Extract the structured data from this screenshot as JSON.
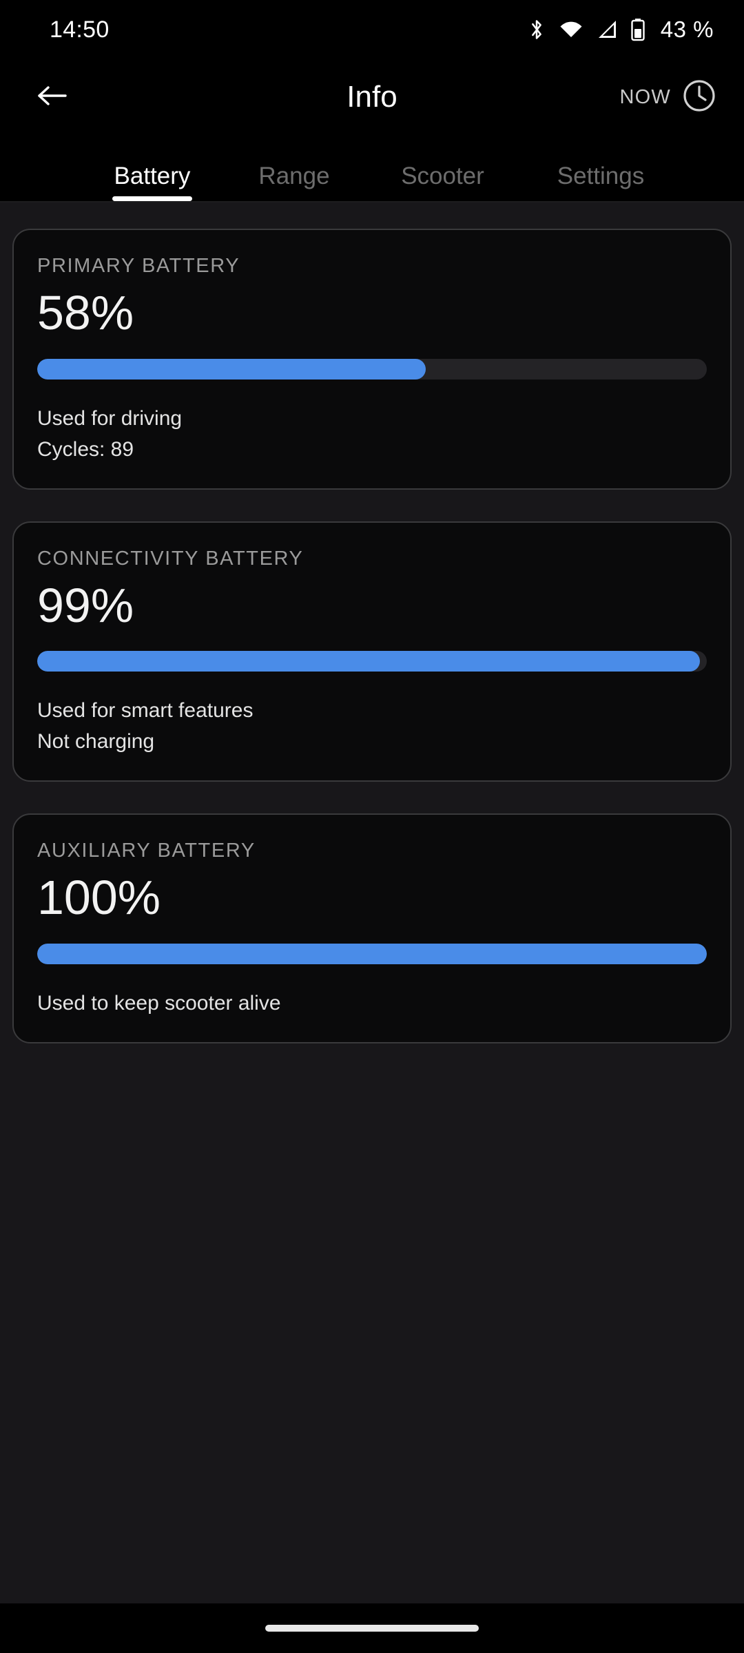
{
  "status_bar": {
    "time": "14:50",
    "battery_percent": "43 %",
    "icons": [
      "bluetooth-icon",
      "wifi-icon",
      "cellular-signal-icon",
      "battery-icon"
    ]
  },
  "header": {
    "back_icon": "arrow-left-icon",
    "title": "Info",
    "now_label": "NOW",
    "clock_icon": "clock-icon"
  },
  "tabs": [
    {
      "label": "Battery",
      "active": true
    },
    {
      "label": "Range",
      "active": false
    },
    {
      "label": "Scooter",
      "active": false
    },
    {
      "label": "Settings",
      "active": false
    }
  ],
  "cards": [
    {
      "title": "PRIMARY BATTERY",
      "value": "58%",
      "percent": 58,
      "notes": [
        "Used for driving",
        "Cycles: 89"
      ]
    },
    {
      "title": "CONNECTIVITY BATTERY",
      "value": "99%",
      "percent": 99,
      "notes": [
        "Used for smart features",
        "Not charging"
      ]
    },
    {
      "title": "AUXILIARY BATTERY",
      "value": "100%",
      "percent": 100,
      "notes": [
        "Used to keep scooter alive"
      ]
    }
  ],
  "colors": {
    "accent": "#4a8ce8",
    "track": "#242326",
    "content_bg": "#18171a",
    "card_bg": "#0a0a0b",
    "card_border": "#3a3a3c",
    "tab_active": "#ffffff",
    "tab_inactive": "#6d6d6d"
  },
  "nav_bar": {
    "gesture_pill": "home-gesture-pill"
  }
}
